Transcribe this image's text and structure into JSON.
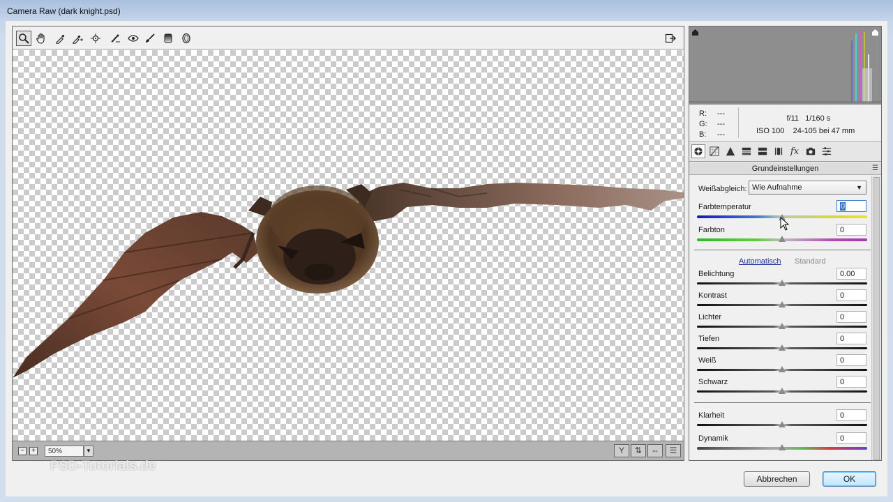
{
  "window": {
    "title": "Camera Raw (dark knight.psd)"
  },
  "toolbar": {
    "tools": [
      "zoom-tool",
      "hand-tool",
      "white-balance-tool",
      "color-sampler-tool",
      "targeted-adjustment-tool",
      "crop-tool",
      "straighten-tool",
      "spot-removal-tool",
      "red-eye-tool",
      "adjustment-brush",
      "graduated-filter",
      "radial-filter"
    ],
    "fullscreen_icon": "fullscreen-icon"
  },
  "statusbar": {
    "zoom": "50%"
  },
  "info": {
    "r_label": "R:",
    "r_value": "---",
    "g_label": "G:",
    "g_value": "---",
    "b_label": "B:",
    "b_value": "---",
    "aperture": "f/11",
    "shutter": "1/160 s",
    "iso": "ISO 100",
    "lens": "24-105 bei 47 mm"
  },
  "panel": {
    "section_title": "Grundeinstellungen",
    "white_balance_label": "Weißabgleich:",
    "white_balance_value": "Wie Aufnahme",
    "auto_link": "Automatisch",
    "standard_link": "Standard",
    "sliders": [
      {
        "label": "Farbtemperatur",
        "value": "0"
      },
      {
        "label": "Farbton",
        "value": "0"
      },
      {
        "label": "Belichtung",
        "value": "0.00"
      },
      {
        "label": "Kontrast",
        "value": "0"
      },
      {
        "label": "Lichter",
        "value": "0"
      },
      {
        "label": "Tiefen",
        "value": "0"
      },
      {
        "label": "Weiß",
        "value": "0"
      },
      {
        "label": "Schwarz",
        "value": "0"
      },
      {
        "label": "Klarheit",
        "value": "0"
      },
      {
        "label": "Dynamik",
        "value": "0"
      }
    ]
  },
  "buttons": {
    "cancel": "Abbrechen",
    "ok": "OK"
  },
  "watermark": "PSD-Tutorials.de",
  "colors": {
    "accent": "#3371c5",
    "link": "#1c2f9e"
  }
}
